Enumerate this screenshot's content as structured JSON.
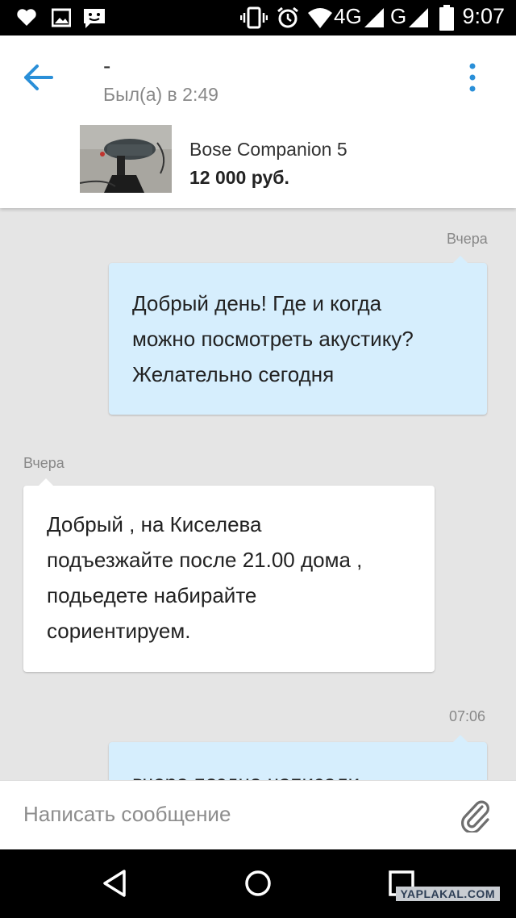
{
  "status_bar": {
    "time": "9:07",
    "network_4g": "4G",
    "network_g": "G",
    "icons": [
      "heart-icon",
      "image-icon",
      "chat-icon",
      "vibrate-icon",
      "alarm-icon",
      "wifi-icon",
      "signal-icon",
      "battery-icon"
    ]
  },
  "header": {
    "name": "-",
    "last_seen": "Был(а) в 2:49",
    "product_title": "Bose Companion 5",
    "product_price": "12 000 руб."
  },
  "messages": [
    {
      "direction": "outgoing",
      "time": "Вчера",
      "text": "Добрый день! Где и когда\nможно посмотреть акустику?\nЖелательно сегодня"
    },
    {
      "direction": "incoming",
      "time": "Вчера",
      "text": "Добрый , на Киселева\nподъезжайте после 21.00  дома ,\nподьедете набирайте\nсориентируем."
    },
    {
      "direction": "outgoing",
      "time": "07:06",
      "text": "вчера поздно написали"
    }
  ],
  "composer": {
    "placeholder": "Написать сообщение"
  },
  "watermark": "YAPLAKAL.COM",
  "colors": {
    "outgoing_bubble": "#d6eefd",
    "incoming_bubble": "#ffffff",
    "accent": "#2a8fd8",
    "chat_background": "#e5e5e5"
  }
}
